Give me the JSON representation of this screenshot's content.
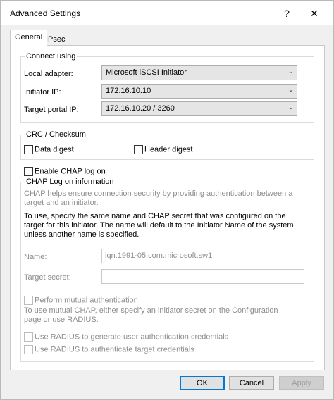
{
  "window": {
    "title": "Advanced Settings",
    "help_label": "?",
    "close_label": "✕"
  },
  "tabs": [
    {
      "label": "General",
      "active": true
    },
    {
      "label": "IPsec",
      "active": false
    }
  ],
  "connect": {
    "legend": "Connect using",
    "local_adapter_label": "Local adapter:",
    "local_adapter_value": "Microsoft iSCSI Initiator",
    "initiator_ip_label": "Initiator IP:",
    "initiator_ip_value": "172.16.10.10",
    "target_portal_label": "Target portal IP:",
    "target_portal_value": "172.16.10.20 / 3260"
  },
  "crc": {
    "legend": "CRC / Checksum",
    "data_digest_label": "Data digest",
    "header_digest_label": "Header digest"
  },
  "chap": {
    "enable_label": "Enable CHAP log on",
    "legend": "CHAP Log on information",
    "help_text": "CHAP helps ensure connection security by providing authentication between a target and an initiator.",
    "instructions_text": "To use, specify the same name and CHAP secret that was configured on the target for this initiator.  The name will default to the Initiator Name of the system unless another name is specified.",
    "name_label": "Name:",
    "name_value": "iqn.1991-05.com.microsoft:sw1",
    "secret_label": "Target secret:",
    "secret_value": "",
    "mutual_label": "Perform mutual authentication",
    "mutual_text": "To use mutual CHAP, either specify an initiator secret on the Configuration page or use RADIUS.",
    "radius_user_label": "Use RADIUS to generate user authentication credentials",
    "radius_target_label": "Use RADIUS to authenticate target credentials"
  },
  "buttons": {
    "ok": "OK",
    "cancel": "Cancel",
    "apply": "Apply"
  },
  "icons": {
    "dropdown": "chevron-down-icon"
  },
  "colors": {
    "default_button_border": "#0078d7",
    "dialog_background": "#f0f0f0"
  }
}
